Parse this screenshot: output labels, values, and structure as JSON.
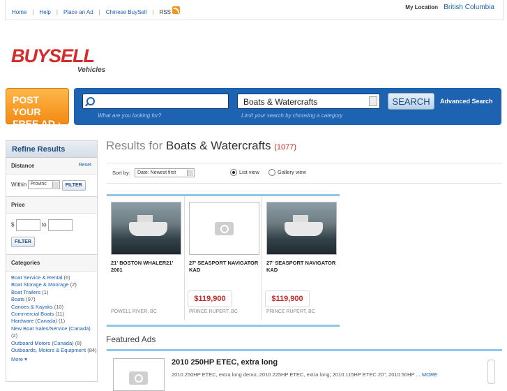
{
  "topnav": {
    "items": [
      "Home",
      "Help",
      "Place an Ad",
      "Chinese BuySell",
      "RSS"
    ],
    "location_label": "My Location",
    "location_value": "British Columbia"
  },
  "logo": {
    "word": "BUYSELL",
    "sub": "Vehicles"
  },
  "post_ad": {
    "line1": "POST YOUR",
    "line2": "FREE AD ›"
  },
  "search": {
    "placeholder": "",
    "hint_left": "What are you looking for?",
    "category": "Boats & Watercrafts",
    "hint_right": "Limit your search by choosing a category",
    "button": "SEARCH",
    "advanced": "Advanced Search"
  },
  "sidebar": {
    "title": "Refine Results",
    "distance": {
      "label": "Distance",
      "reset": "Reset",
      "within": "Within",
      "select": "Provinc",
      "button": "FILTER"
    },
    "price": {
      "label": "Price",
      "currency": "$",
      "to": "to",
      "button": "FILTER"
    },
    "categories": {
      "label": "Categories",
      "items": [
        {
          "name": "Boat Service & Rental",
          "count": "(6)"
        },
        {
          "name": "Boat Storage & Moorage",
          "count": "(2)"
        },
        {
          "name": "Boat Trailers",
          "count": "(1)"
        },
        {
          "name": "Boats",
          "count": "(97)"
        },
        {
          "name": "Canoes & Kayaks",
          "count": "(10)"
        },
        {
          "name": "Commercial Boats",
          "count": "(11)"
        },
        {
          "name": "Hardware (Canada)",
          "count": "(1)"
        },
        {
          "name": "New Boat Sales/Service (Canada)",
          "count": "(2)"
        },
        {
          "name": "Outboard Motors (Canada)",
          "count": "(8)"
        },
        {
          "name": "Outboards, Motors & Equipment",
          "count": "(84)"
        }
      ],
      "more": "More ▾"
    }
  },
  "results": {
    "prefix": "Results for",
    "category": "Boats & Watercrafts",
    "count": "(1077)"
  },
  "sortbar": {
    "label": "Sort by:",
    "value": "Date: Newest first",
    "list_view": "List view",
    "gallery_view": "Gallery view"
  },
  "listings": [
    {
      "title": "21' BOSTON WHALER21' 2001",
      "price": "",
      "location": "POWELL RIVER, BC",
      "photo": true
    },
    {
      "title": "27' SEASPORT NAVIGATOR KAD",
      "price": "$119,900",
      "location": "PRINCE RUPERT, BC",
      "photo": false
    },
    {
      "title": "27' SEASPORT NAVIGATOR KAD",
      "price": "$119,900",
      "location": "PRINCE RUPERT, BC",
      "photo": true
    }
  ],
  "featured": {
    "label": "Featured Ads",
    "title": "2010 250HP ETEC, extra long",
    "desc": "2010 250HP ETEC, extra long demo; 2010 225HP ETEC, extra long; 2010 115HP ETEC 20\"; 2010 50HP ...",
    "more": "MORE"
  },
  "colors": {
    "accent": "#1d63b1",
    "brand_red": "#d52b2b",
    "price_red": "#c62828",
    "orange": "#f38a14"
  }
}
